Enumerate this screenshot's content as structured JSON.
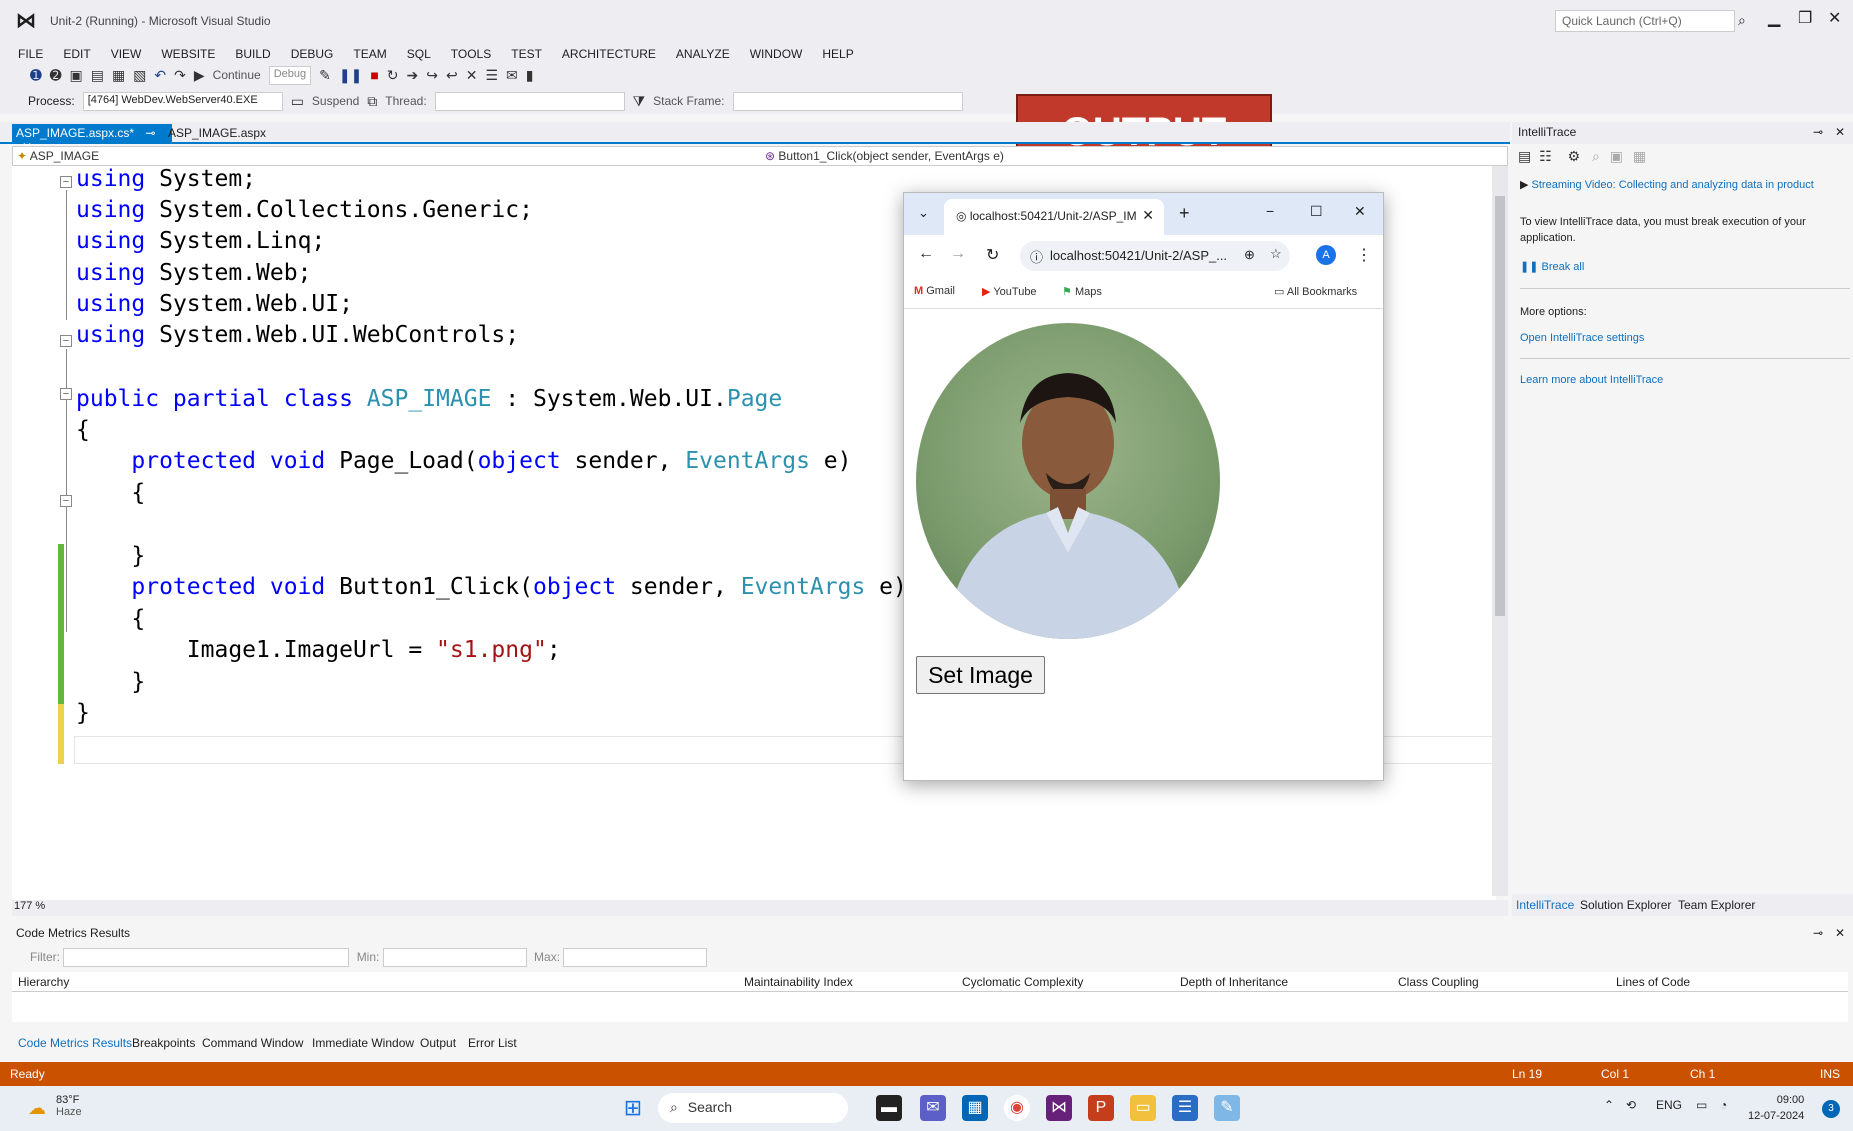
{
  "window": {
    "title": "Unit-2 (Running) - Microsoft Visual Studio",
    "quick_launch_placeholder": "Quick Launch (Ctrl+Q)"
  },
  "menu": [
    "FILE",
    "EDIT",
    "VIEW",
    "WEBSITE",
    "BUILD",
    "DEBUG",
    "TEAM",
    "SQL",
    "TOOLS",
    "TEST",
    "ARCHITECTURE",
    "ANALYZE",
    "WINDOW",
    "HELP"
  ],
  "toolbar": {
    "continue_label": "Continue",
    "config_value": "Debug",
    "process_label": "Process:",
    "process_value": "[4764] WebDev.WebServer40.EXE",
    "suspend_label": "Suspend",
    "thread_label": "Thread:",
    "stack_frame_label": "Stack Frame:"
  },
  "banner": {
    "text": "OUTPUT"
  },
  "tabs": {
    "active": "ASP_IMAGE.aspx.cs*",
    "inactive": "ASP_IMAGE.aspx"
  },
  "navbar": {
    "left": "ASP_IMAGE",
    "right": "Button1_Click(object sender, EventArgs e)"
  },
  "code": {
    "l1_kw": "using",
    "l1_rest": " System;",
    "l2_kw": "using",
    "l2_rest": " System.Collections.Generic;",
    "l3_kw": "using",
    "l3_rest": " System.Linq;",
    "l4_kw": "using",
    "l4_rest": " System.Web;",
    "l5_kw": "using",
    "l5_rest": " System.Web.UI;",
    "l6_kw": "using",
    "l6_rest": " System.Web.UI.WebControls;",
    "l7_kw": "public partial class",
    "l7_class": " ASP_IMAGE",
    "l7_mid": " : System.Web.UI.",
    "l7_type": "Page",
    "l8": "{",
    "l9_kw": "    protected void",
    "l9_name": " Page_Load(",
    "l9_kw2": "object",
    "l9_mid": " sender, ",
    "l9_type": "EventArgs",
    "l9_end": " e)",
    "l10": "    {",
    "l12": "    }",
    "l13_kw": "    protected void",
    "l13_name": " Button1_Click(",
    "l13_kw2": "object",
    "l13_mid": " sender, ",
    "l13_type": "EventArgs",
    "l13_end": " e)",
    "l14": "    {",
    "l15_pre": "        Image1.ImageUrl = ",
    "l15_str": "\"s1.png\"",
    "l15_end": ";",
    "l16": "    }",
    "l17": "}"
  },
  "zoom": "177 %",
  "browser": {
    "tab_title": "localhost:50421/Unit-2/ASP_IM",
    "address": "localhost:50421/Unit-2/ASP_...",
    "avatar": "A",
    "bookmarks": [
      "Gmail",
      "YouTube",
      "Maps"
    ],
    "all_bookmarks": "All Bookmarks",
    "button_label": "Set Image"
  },
  "intellitrace": {
    "title": "IntelliTrace",
    "video_link": "Streaming Video: Collecting and analyzing data in product",
    "info": "To view IntelliTrace data, you must break execution of your application.",
    "break_all": "Break all",
    "more_options": "More options:",
    "settings_link": "Open IntelliTrace settings",
    "learn_link": "Learn more about IntelliTrace",
    "tabs": [
      "IntelliTrace",
      "Solution Explorer",
      "Team Explorer"
    ]
  },
  "code_metrics": {
    "title": "Code Metrics Results",
    "filter_label": "Filter:",
    "min_label": "Min:",
    "max_label": "Max:",
    "columns": [
      "Hierarchy",
      "Maintainability Index",
      "Cyclomatic Complexity",
      "Depth of Inheritance",
      "Class Coupling",
      "Lines of Code"
    ],
    "tabs": [
      "Code Metrics Results",
      "Breakpoints",
      "Command Window",
      "Immediate Window",
      "Output",
      "Error List"
    ]
  },
  "status": {
    "ready": "Ready",
    "ln": "Ln 19",
    "col": "Col 1",
    "ch": "Ch 1",
    "ins": "INS"
  },
  "taskbar": {
    "temp": "83°F",
    "weather": "Haze",
    "search": "Search",
    "lang": "ENG",
    "time": "09:00",
    "date": "12-07-2024",
    "notif": "3"
  },
  "colors": {
    "accent": "#007acc",
    "status": "#ca5100",
    "banner": "#c0392b"
  }
}
